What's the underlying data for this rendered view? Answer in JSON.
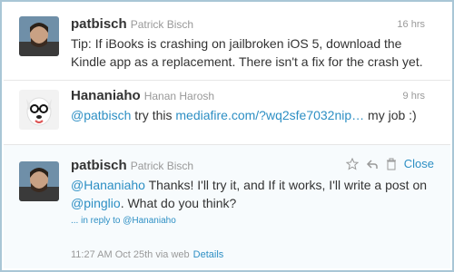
{
  "tweets": [
    {
      "screen_name": "patbisch",
      "full_name": "Patrick Bisch",
      "time": "16 hrs",
      "text": "Tip: If iBooks is crashing on jailbroken iOS 5, download the Kindle app as a replacement. There isn't a fix for the crash yet."
    },
    {
      "screen_name": "Hananiaho",
      "full_name": "Hanan Harosh",
      "time": "9 hrs",
      "mention": "@patbisch",
      "text_a": " try this ",
      "link": "mediafire.com/?wq2sfe7032nip",
      "ellipsis": "…",
      "text_b": " my job :)"
    },
    {
      "screen_name": "patbisch",
      "full_name": "Patrick Bisch",
      "mention": "@Hananiaho",
      "text_a": " Thanks! I'll try it, and If it works, I'll write a post on ",
      "mention2": "@pinglio",
      "text_b": ". What do you think?",
      "reply_context": "... in reply to @Hananiaho",
      "timestamp": "11:27 AM Oct 25th via web",
      "details": "Details",
      "close": "Close"
    }
  ],
  "icons": [
    "star-icon",
    "reply-icon",
    "trash-icon"
  ],
  "colors": {
    "link": "#2d8fc4",
    "meta": "#999999",
    "text": "#333333"
  }
}
